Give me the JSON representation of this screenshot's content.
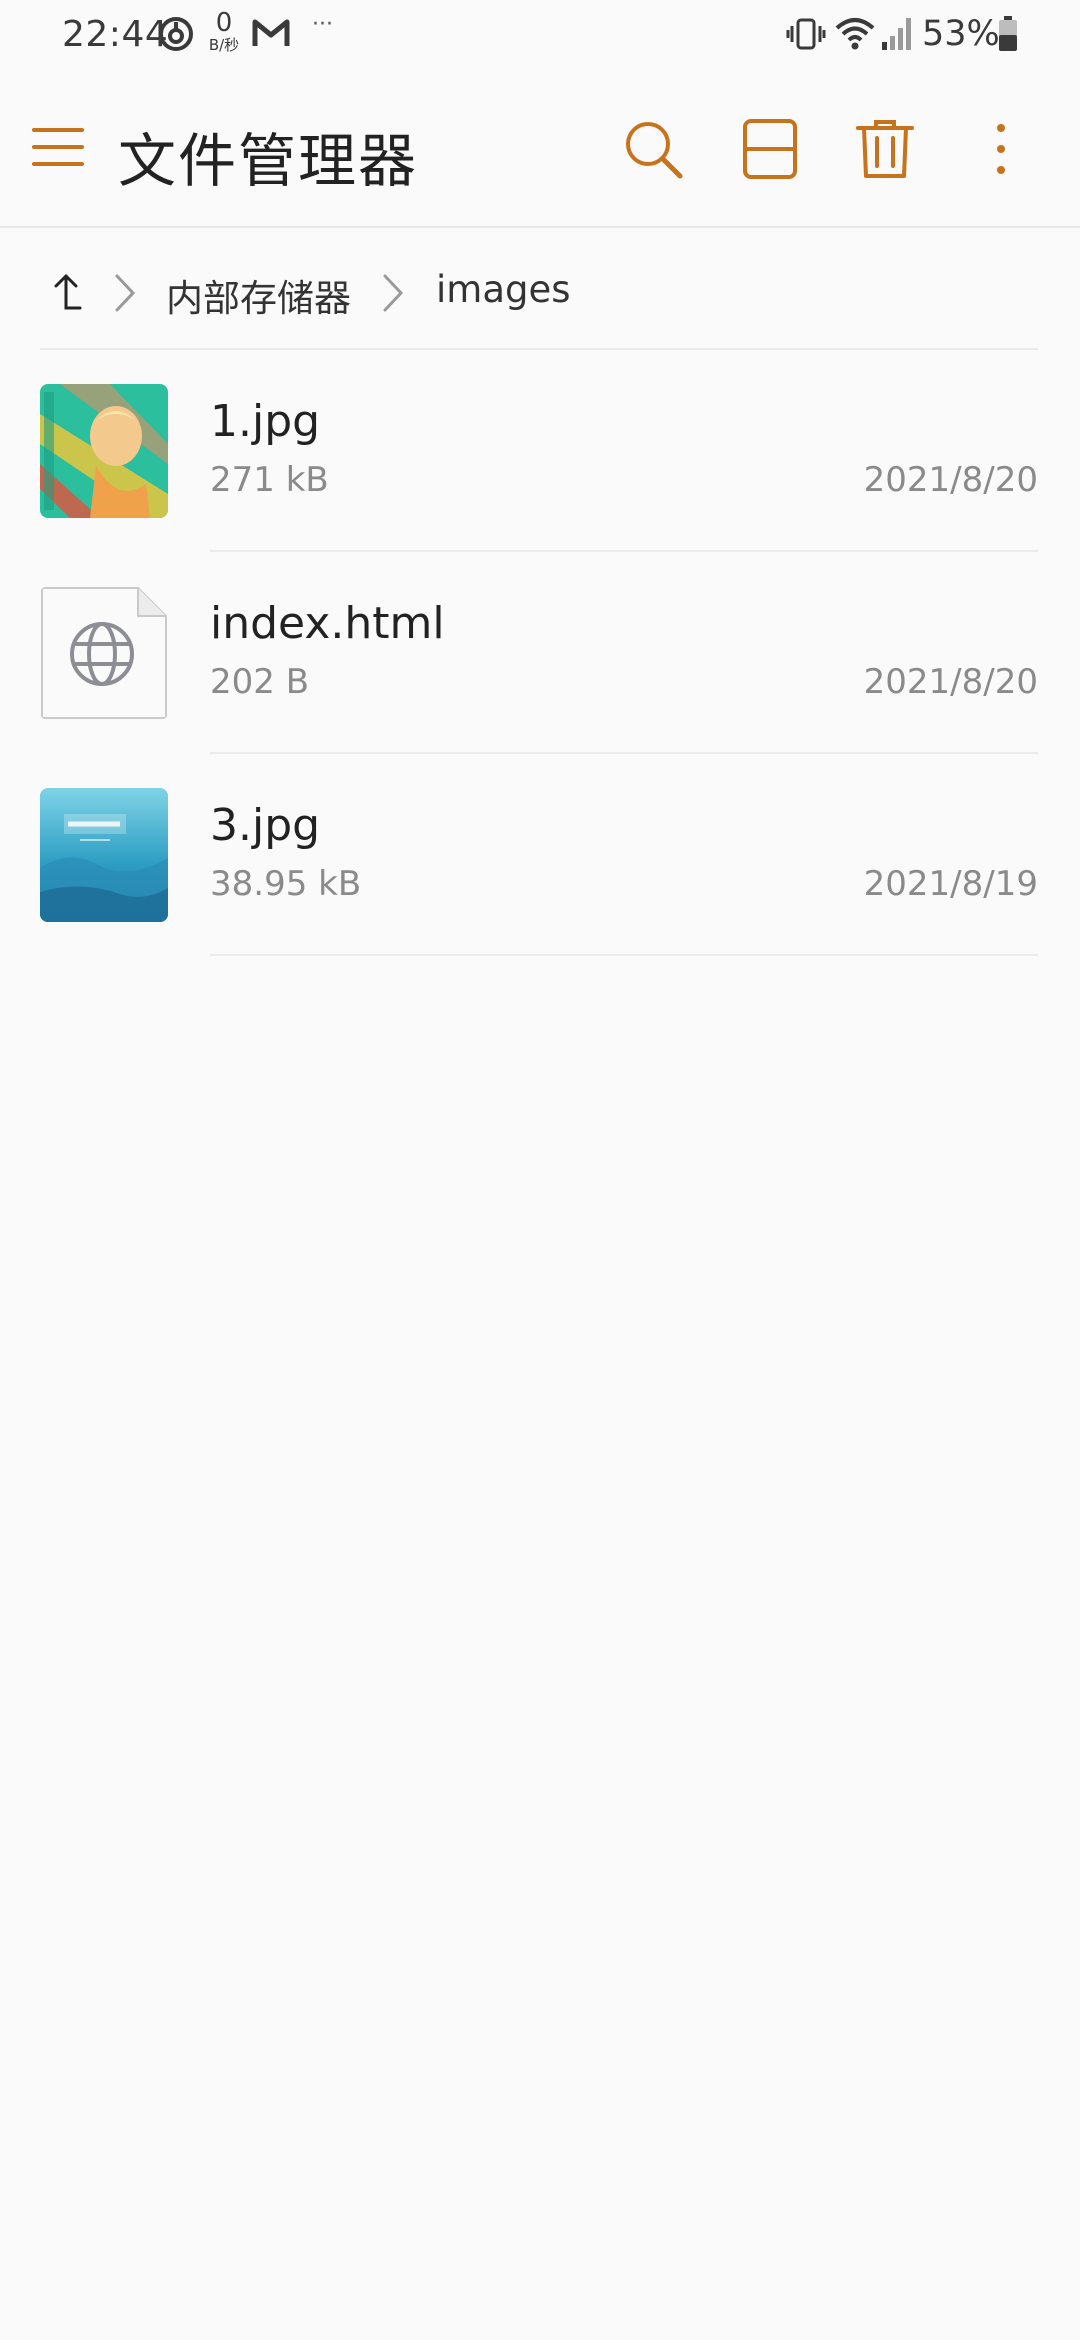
{
  "status_bar": {
    "time": "22:44",
    "net_speed_value": "0",
    "net_speed_unit": "B/秒",
    "more": "···",
    "battery_text": "53%"
  },
  "app_bar": {
    "title": "文件管理器",
    "accent_color": "#c7731c"
  },
  "breadcrumb": {
    "items": [
      "内部存储器",
      "images"
    ]
  },
  "files": [
    {
      "name": "1.jpg",
      "size": "271 kB",
      "date": "2021/8/20",
      "icon": "image-thumbnail"
    },
    {
      "name": "index.html",
      "size": "202 B",
      "date": "2021/8/20",
      "icon": "globe-icon"
    },
    {
      "name": "3.jpg",
      "size": "38.95 kB",
      "date": "2021/8/19",
      "icon": "image-thumbnail"
    }
  ]
}
